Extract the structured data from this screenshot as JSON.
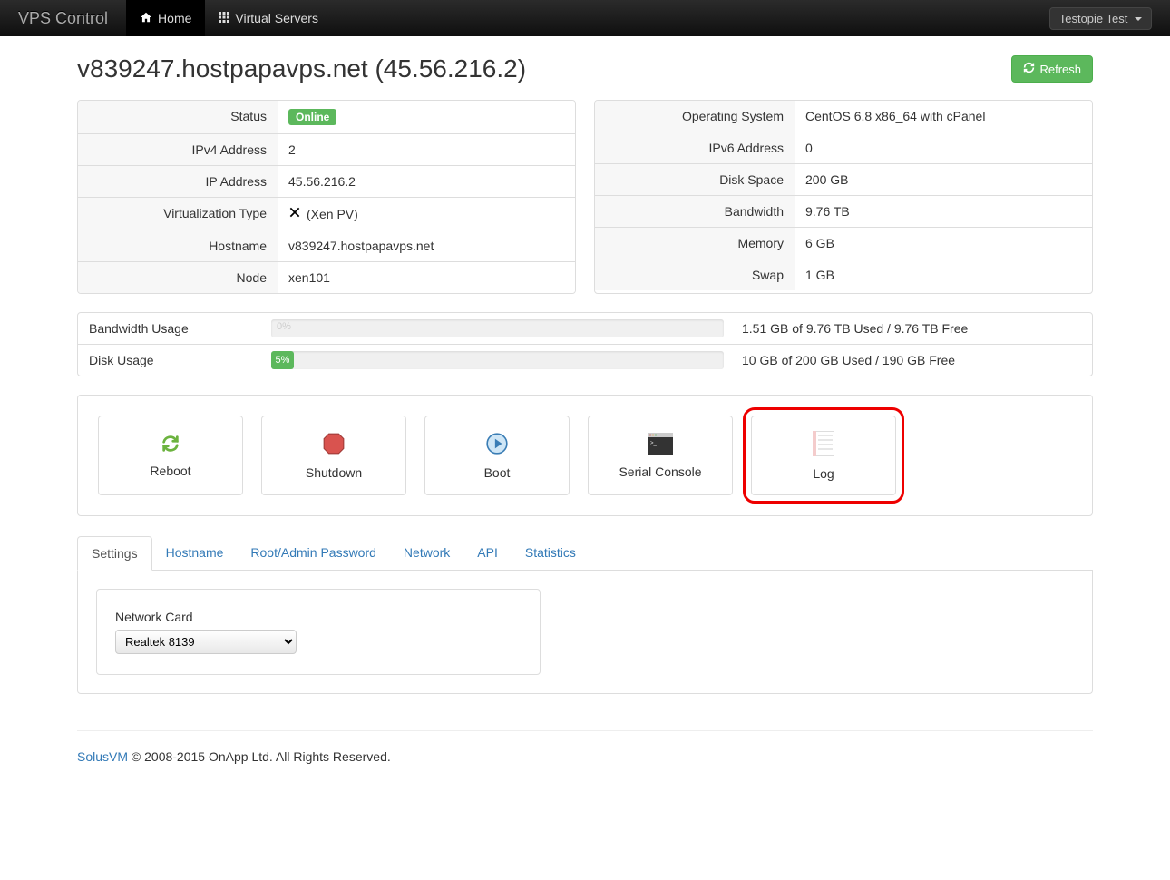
{
  "nav": {
    "brand": "VPS Control",
    "home": "Home",
    "vservers": "Virtual Servers",
    "user": "Testopie Test"
  },
  "header": {
    "title": "v839247.hostpapavps.net (45.56.216.2)",
    "refresh": "Refresh"
  },
  "left": {
    "status_label": "Status",
    "status_badge": "Online",
    "ipv4_label": "IPv4 Address",
    "ipv4_value": "2",
    "ip_label": "IP Address",
    "ip_value": "45.56.216.2",
    "virt_label": "Virtualization Type",
    "virt_value": "(Xen PV)",
    "host_label": "Hostname",
    "host_value": "v839247.hostpapavps.net",
    "node_label": "Node",
    "node_value": "xen101"
  },
  "right": {
    "os_label": "Operating System",
    "os_value": "CentOS 6.8 x86_64 with cPanel",
    "ipv6_label": "IPv6 Address",
    "ipv6_value": "0",
    "disk_label": "Disk Space",
    "disk_value": "200 GB",
    "bw_label": "Bandwidth",
    "bw_value": "9.76 TB",
    "mem_label": "Memory",
    "mem_value": "6 GB",
    "swap_label": "Swap",
    "swap_value": "1 GB"
  },
  "usage": {
    "bw_label": "Bandwidth Usage",
    "bw_pct_text": "0%",
    "bw_pct": 0,
    "bw_text": "1.51 GB of 9.76 TB Used / 9.76 TB Free",
    "disk_label": "Disk Usage",
    "disk_pct_text": "5%",
    "disk_pct": 5,
    "disk_text": "10 GB of 200 GB Used / 190 GB Free"
  },
  "actions": {
    "reboot": "Reboot",
    "shutdown": "Shutdown",
    "boot": "Boot",
    "serial": "Serial Console",
    "log": "Log"
  },
  "tabs": {
    "settings": "Settings",
    "hostname": "Hostname",
    "rootpw": "Root/Admin Password",
    "network": "Network",
    "api": "API",
    "stats": "Statistics"
  },
  "settings": {
    "nic_label": "Network Card",
    "nic_value": "Realtek 8139"
  },
  "footer": {
    "link": "SolusVM",
    "text": " © 2008-2015 OnApp Ltd. All Rights Reserved."
  }
}
